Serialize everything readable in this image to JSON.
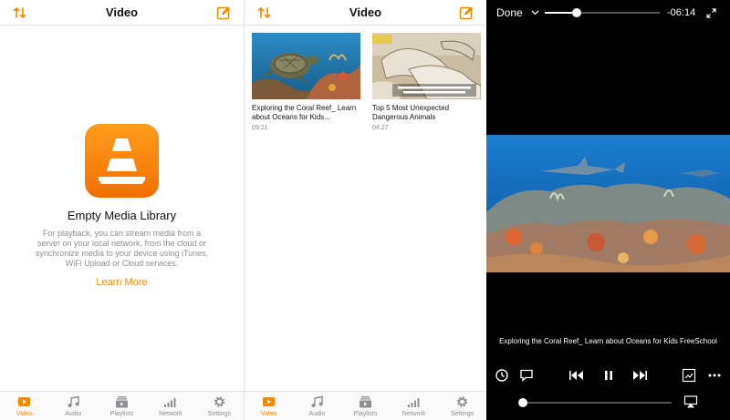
{
  "library_pane": {
    "nav": {
      "title": "Video"
    },
    "empty": {
      "title": "Empty Media Library",
      "body": "For playback, you can stream media from a server on your local network, from the cloud or synchronize media to your device using iTunes, WiFi Upload or Cloud services.",
      "link": "Learn More"
    },
    "tabs": [
      {
        "label": "Video",
        "icon": "video-icon",
        "active": true
      },
      {
        "label": "Audio",
        "icon": "music-note-icon",
        "active": false
      },
      {
        "label": "Playlists",
        "icon": "playlist-icon",
        "active": false
      },
      {
        "label": "Network",
        "icon": "signal-bars-icon",
        "active": false
      },
      {
        "label": "Settings",
        "icon": "gear-icon",
        "active": false
      }
    ]
  },
  "grid_pane": {
    "nav": {
      "title": "Video"
    },
    "videos": [
      {
        "title": "Exploring the Coral Reef_ Learn about Oceans for Kids...",
        "duration": "09:21"
      },
      {
        "title": "Top 5 Most Unexpected Dangerous Animals",
        "duration": "04:27"
      }
    ],
    "tabs": [
      {
        "label": "Video",
        "icon": "video-icon",
        "active": true
      },
      {
        "label": "Audio",
        "icon": "music-note-icon",
        "active": false
      },
      {
        "label": "Playlists",
        "icon": "playlist-icon",
        "active": false
      },
      {
        "label": "Network",
        "icon": "signal-bars-icon",
        "active": false
      },
      {
        "label": "Settings",
        "icon": "gear-icon",
        "active": false
      }
    ]
  },
  "player": {
    "done_label": "Done",
    "remaining": "-06:14",
    "progress": 0.28,
    "subtitle": "Exploring the Coral Reef_ Learn about Oceans for Kids FreeSchool",
    "volume": 0.0
  },
  "colors": {
    "accent": "#f08a00",
    "tab_inactive": "#8e8e93"
  }
}
